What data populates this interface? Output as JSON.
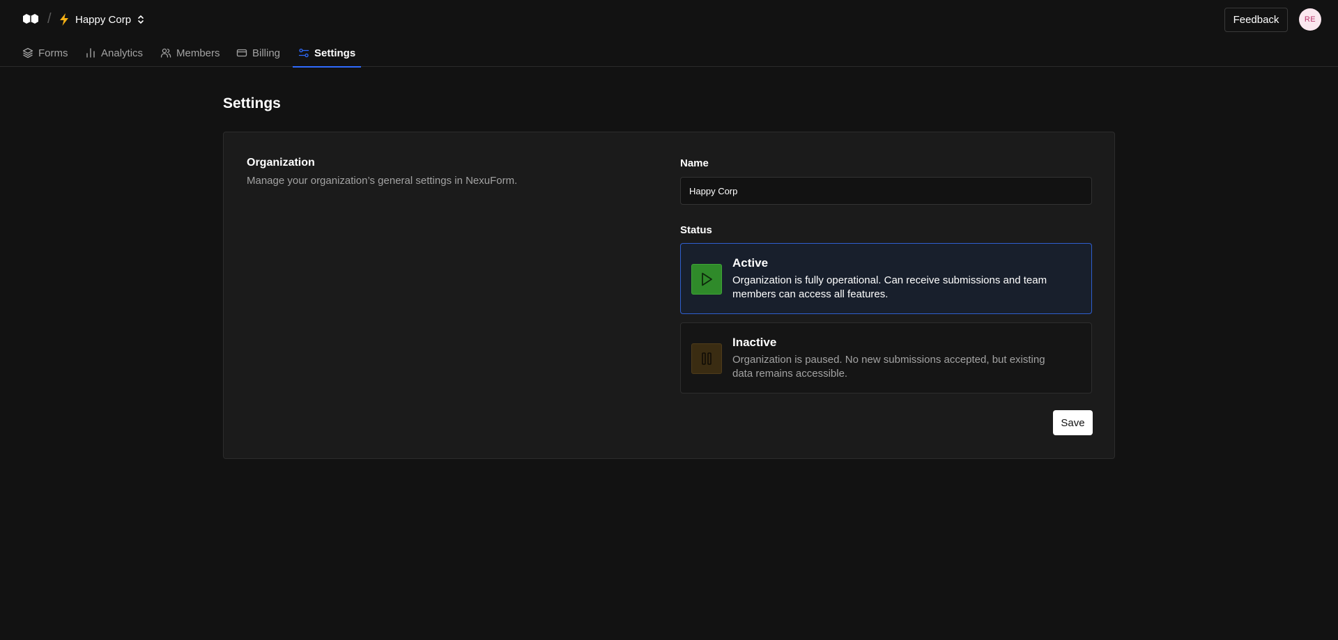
{
  "header": {
    "separator": "/",
    "org_name": "Happy Corp",
    "feedback_label": "Feedback",
    "avatar_initials": "RE",
    "icons": [
      "logo-icon",
      "bolt-icon",
      "chevron-up-down-icon"
    ]
  },
  "nav": {
    "tabs": [
      {
        "label": "Forms",
        "icon": "layers-icon"
      },
      {
        "label": "Analytics",
        "icon": "bar-chart-icon"
      },
      {
        "label": "Members",
        "icon": "users-icon"
      },
      {
        "label": "Billing",
        "icon": "credit-card-icon"
      },
      {
        "label": "Settings",
        "icon": "sliders-icon",
        "active": true
      }
    ]
  },
  "page": {
    "title": "Settings"
  },
  "organization": {
    "title": "Organization",
    "description": "Manage your organization’s general settings in NexuForm.",
    "name_label": "Name",
    "name_value": "Happy Corp",
    "status_label": "Status",
    "status_options": [
      {
        "title": "Active",
        "description": "Organization is fully operational. Can receive submissions and team members can access all features.",
        "icon": "play-icon",
        "selected": true
      },
      {
        "title": "Inactive",
        "description": "Organization is paused. No new submissions accepted, but existing data remains accessible.",
        "icon": "pause-icon",
        "selected": false
      }
    ],
    "save_label": "Save"
  },
  "colors": {
    "background": "#121212",
    "card": "#1b1b1b",
    "accent": "#2f6bff",
    "active_green": "#2f8a2a",
    "inactive_amber": "#3a2c12",
    "bolt": "#f5b014"
  }
}
